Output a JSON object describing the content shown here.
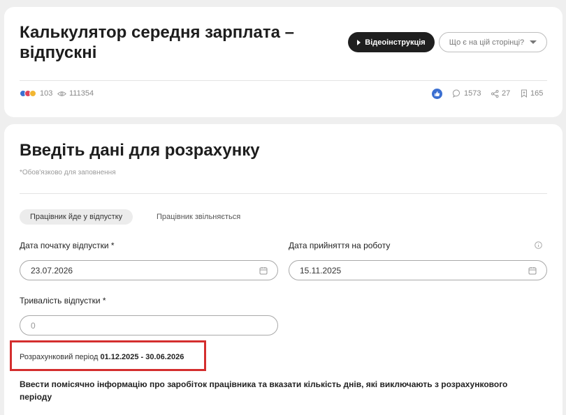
{
  "header": {
    "title": "Калькулятор середня зарплата – відпускні",
    "video_button_label": "Відеоінструкція",
    "help_dropdown_label": "Що є на цій сторінці?"
  },
  "stats": {
    "reactions_count": "103",
    "views_count": "111354",
    "comments_count": "1573",
    "shares_count": "27",
    "bookmarks_count": "165"
  },
  "form": {
    "title": "Введіть дані для розрахунку",
    "required_note": "*Обов'язково для заповнення",
    "tabs": [
      {
        "label": "Працівник йде у відпустку",
        "active": true
      },
      {
        "label": "Працівник звільняється",
        "active": false
      }
    ],
    "vacation_start": {
      "label": "Дата початку відпустки *",
      "value": "23.07.2026"
    },
    "hire_date": {
      "label": "Дата прийняття на роботу",
      "value": "15.11.2025"
    },
    "duration": {
      "label": "Тривалість відпустки *",
      "placeholder": "0"
    },
    "period": {
      "label": "Розрахунковий період",
      "value": "01.12.2025 - 30.06.2026"
    },
    "instruction": "Ввести помісячно інформацію про заробіток працівника та вказати кількість днів, які виключають з розрахункового періоду"
  },
  "colors": {
    "accent_dark": "#1f1f1f",
    "like_blue": "#3b6fd1",
    "highlight_red": "#d42e2e"
  }
}
